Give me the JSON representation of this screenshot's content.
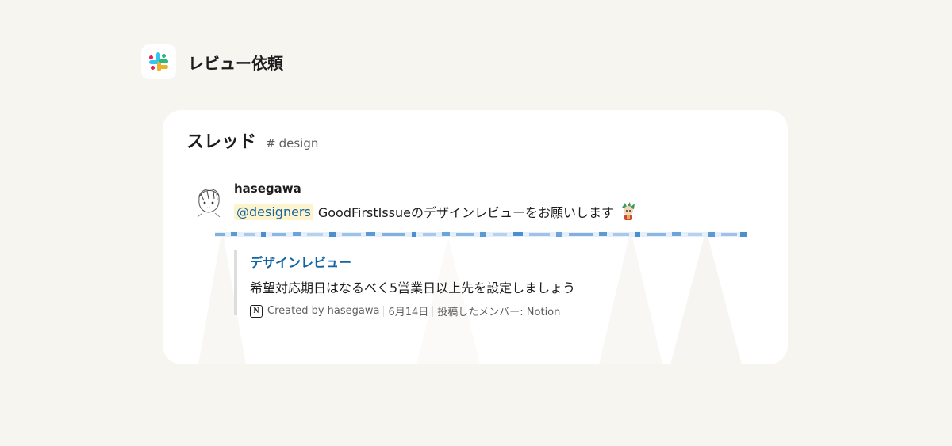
{
  "header": {
    "title": "レビュー依頼",
    "logo_icon": "slack-logo-icon"
  },
  "thread": {
    "title": "スレッド",
    "channel_hash": "#",
    "channel_name": "design"
  },
  "message": {
    "username": "hasegawa",
    "mention": "@designers",
    "text": "GoodFirstIssueのデザインレビューをお願いします",
    "avatar_icon": "sketch-avatar-icon",
    "emoji_icon": "character-emoji-icon"
  },
  "attachment": {
    "title": "デザインレビュー",
    "description": "希望対応期日はなるべく5営業日以上先を設定しましょう",
    "created_by": "Created by hasegawa",
    "date": "6月14日",
    "posted_by": "投稿したメンバー: Notion",
    "icon": "notion-icon"
  },
  "colors": {
    "link": "#1264a3",
    "mention_bg": "#fdf3cd",
    "background": "#f7f5f0"
  }
}
